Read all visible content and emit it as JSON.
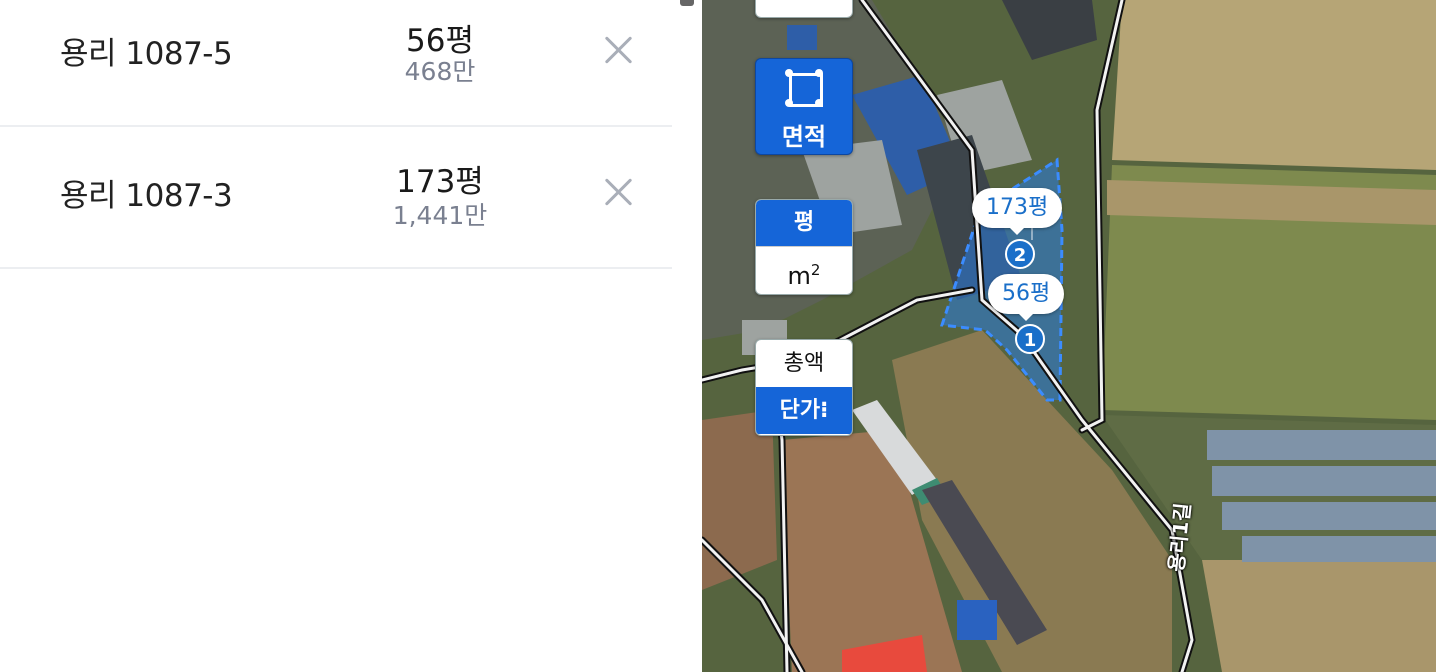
{
  "parcels": [
    {
      "address": "용리 1087-5",
      "area": "56평",
      "price": "468만"
    },
    {
      "address": "용리 1087-3",
      "area": "173평",
      "price": "1,441만"
    }
  ],
  "map": {
    "area_tool_label": "면적",
    "unit_pyeong": "평",
    "unit_m2": "m",
    "unit_m2_sup": "2",
    "price_total": "총액",
    "price_unit": "단가⁝",
    "markers": [
      {
        "num": "2",
        "label": "173평"
      },
      {
        "num": "1",
        "label": "56평"
      }
    ],
    "road_label": "용리1길",
    "colors": {
      "accent": "#1565d8",
      "marker": "#1a6fc9"
    }
  }
}
